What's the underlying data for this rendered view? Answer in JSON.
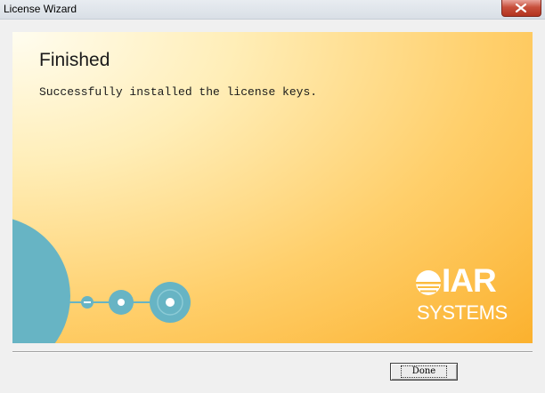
{
  "window": {
    "title": "License Wizard",
    "close_icon": "close-icon"
  },
  "panel": {
    "heading": "Finished",
    "message": "Successfully installed the license keys."
  },
  "logo": {
    "brand": "IAR",
    "systems": "SYSTEMS"
  },
  "footer": {
    "done_label": "Done"
  },
  "colors": {
    "panel_gradient_start": "#fffdf0",
    "panel_gradient_end": "#fbb12e",
    "decor_teal": "#67b4c4",
    "close_button": "#c8503c"
  }
}
